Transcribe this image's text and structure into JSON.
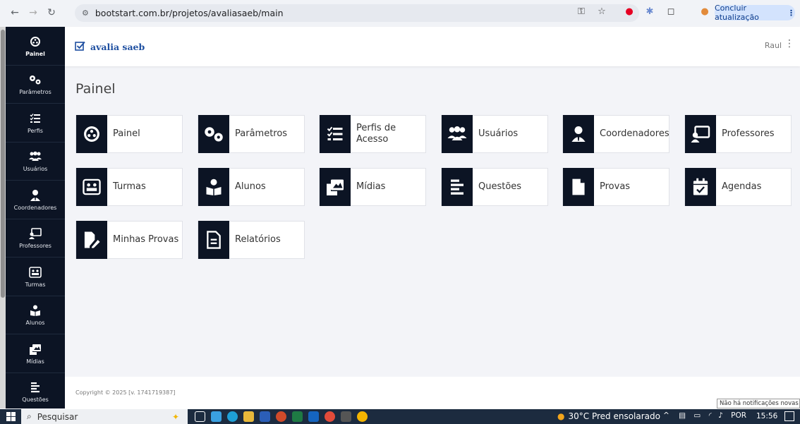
{
  "browser": {
    "url": "bootstart.com.br/projetos/avaliasaeb/main",
    "update_label": "Concluir atualização"
  },
  "app": {
    "brand": "avalia saeb",
    "user": "Raul",
    "page_title": "Painel",
    "copyright": "Copyright © 2025 [v. 1741719387]"
  },
  "sidebar": {
    "items": [
      {
        "label": "Painel",
        "icon": "gauge-icon"
      },
      {
        "label": "Parâmetros",
        "icon": "gears-icon"
      },
      {
        "label": "Perfis",
        "icon": "checklist-icon"
      },
      {
        "label": "Usuários",
        "icon": "users-icon"
      },
      {
        "label": "Coordenadores",
        "icon": "coordinator-icon"
      },
      {
        "label": "Professores",
        "icon": "teacher-icon"
      },
      {
        "label": "Turmas",
        "icon": "class-icon"
      },
      {
        "label": "Alunos",
        "icon": "student-icon"
      },
      {
        "label": "Mídias",
        "icon": "media-icon"
      },
      {
        "label": "Questões",
        "icon": "questions-icon"
      }
    ]
  },
  "tiles": [
    {
      "label": "Painel",
      "icon": "gauge-icon"
    },
    {
      "label": "Parâmetros",
      "icon": "gears-icon"
    },
    {
      "label": "Perfis de Acesso",
      "icon": "checklist-icon"
    },
    {
      "label": "Usuários",
      "icon": "users-icon"
    },
    {
      "label": "Coordenadores",
      "icon": "coordinator-icon"
    },
    {
      "label": "Professores",
      "icon": "teacher-icon"
    },
    {
      "label": "Turmas",
      "icon": "class-icon"
    },
    {
      "label": "Alunos",
      "icon": "student-icon"
    },
    {
      "label": "Mídias",
      "icon": "media-icon"
    },
    {
      "label": "Questões",
      "icon": "questions-icon"
    },
    {
      "label": "Provas",
      "icon": "document-icon"
    },
    {
      "label": "Agendas",
      "icon": "calendar-icon"
    },
    {
      "label": "Minhas Provas",
      "icon": "my-tests-icon"
    },
    {
      "label": "Relatórios",
      "icon": "report-icon"
    }
  ],
  "notification": "Não há notificações novas",
  "taskbar": {
    "search": "Pesquisar",
    "weather": "30°C  Pred ensolarado",
    "language": "POR",
    "time": "15:56"
  },
  "colors": {
    "sidebar_bg": "#0c1424",
    "brand": "#1d4ea0",
    "page_bg": "#f3f4f8"
  }
}
